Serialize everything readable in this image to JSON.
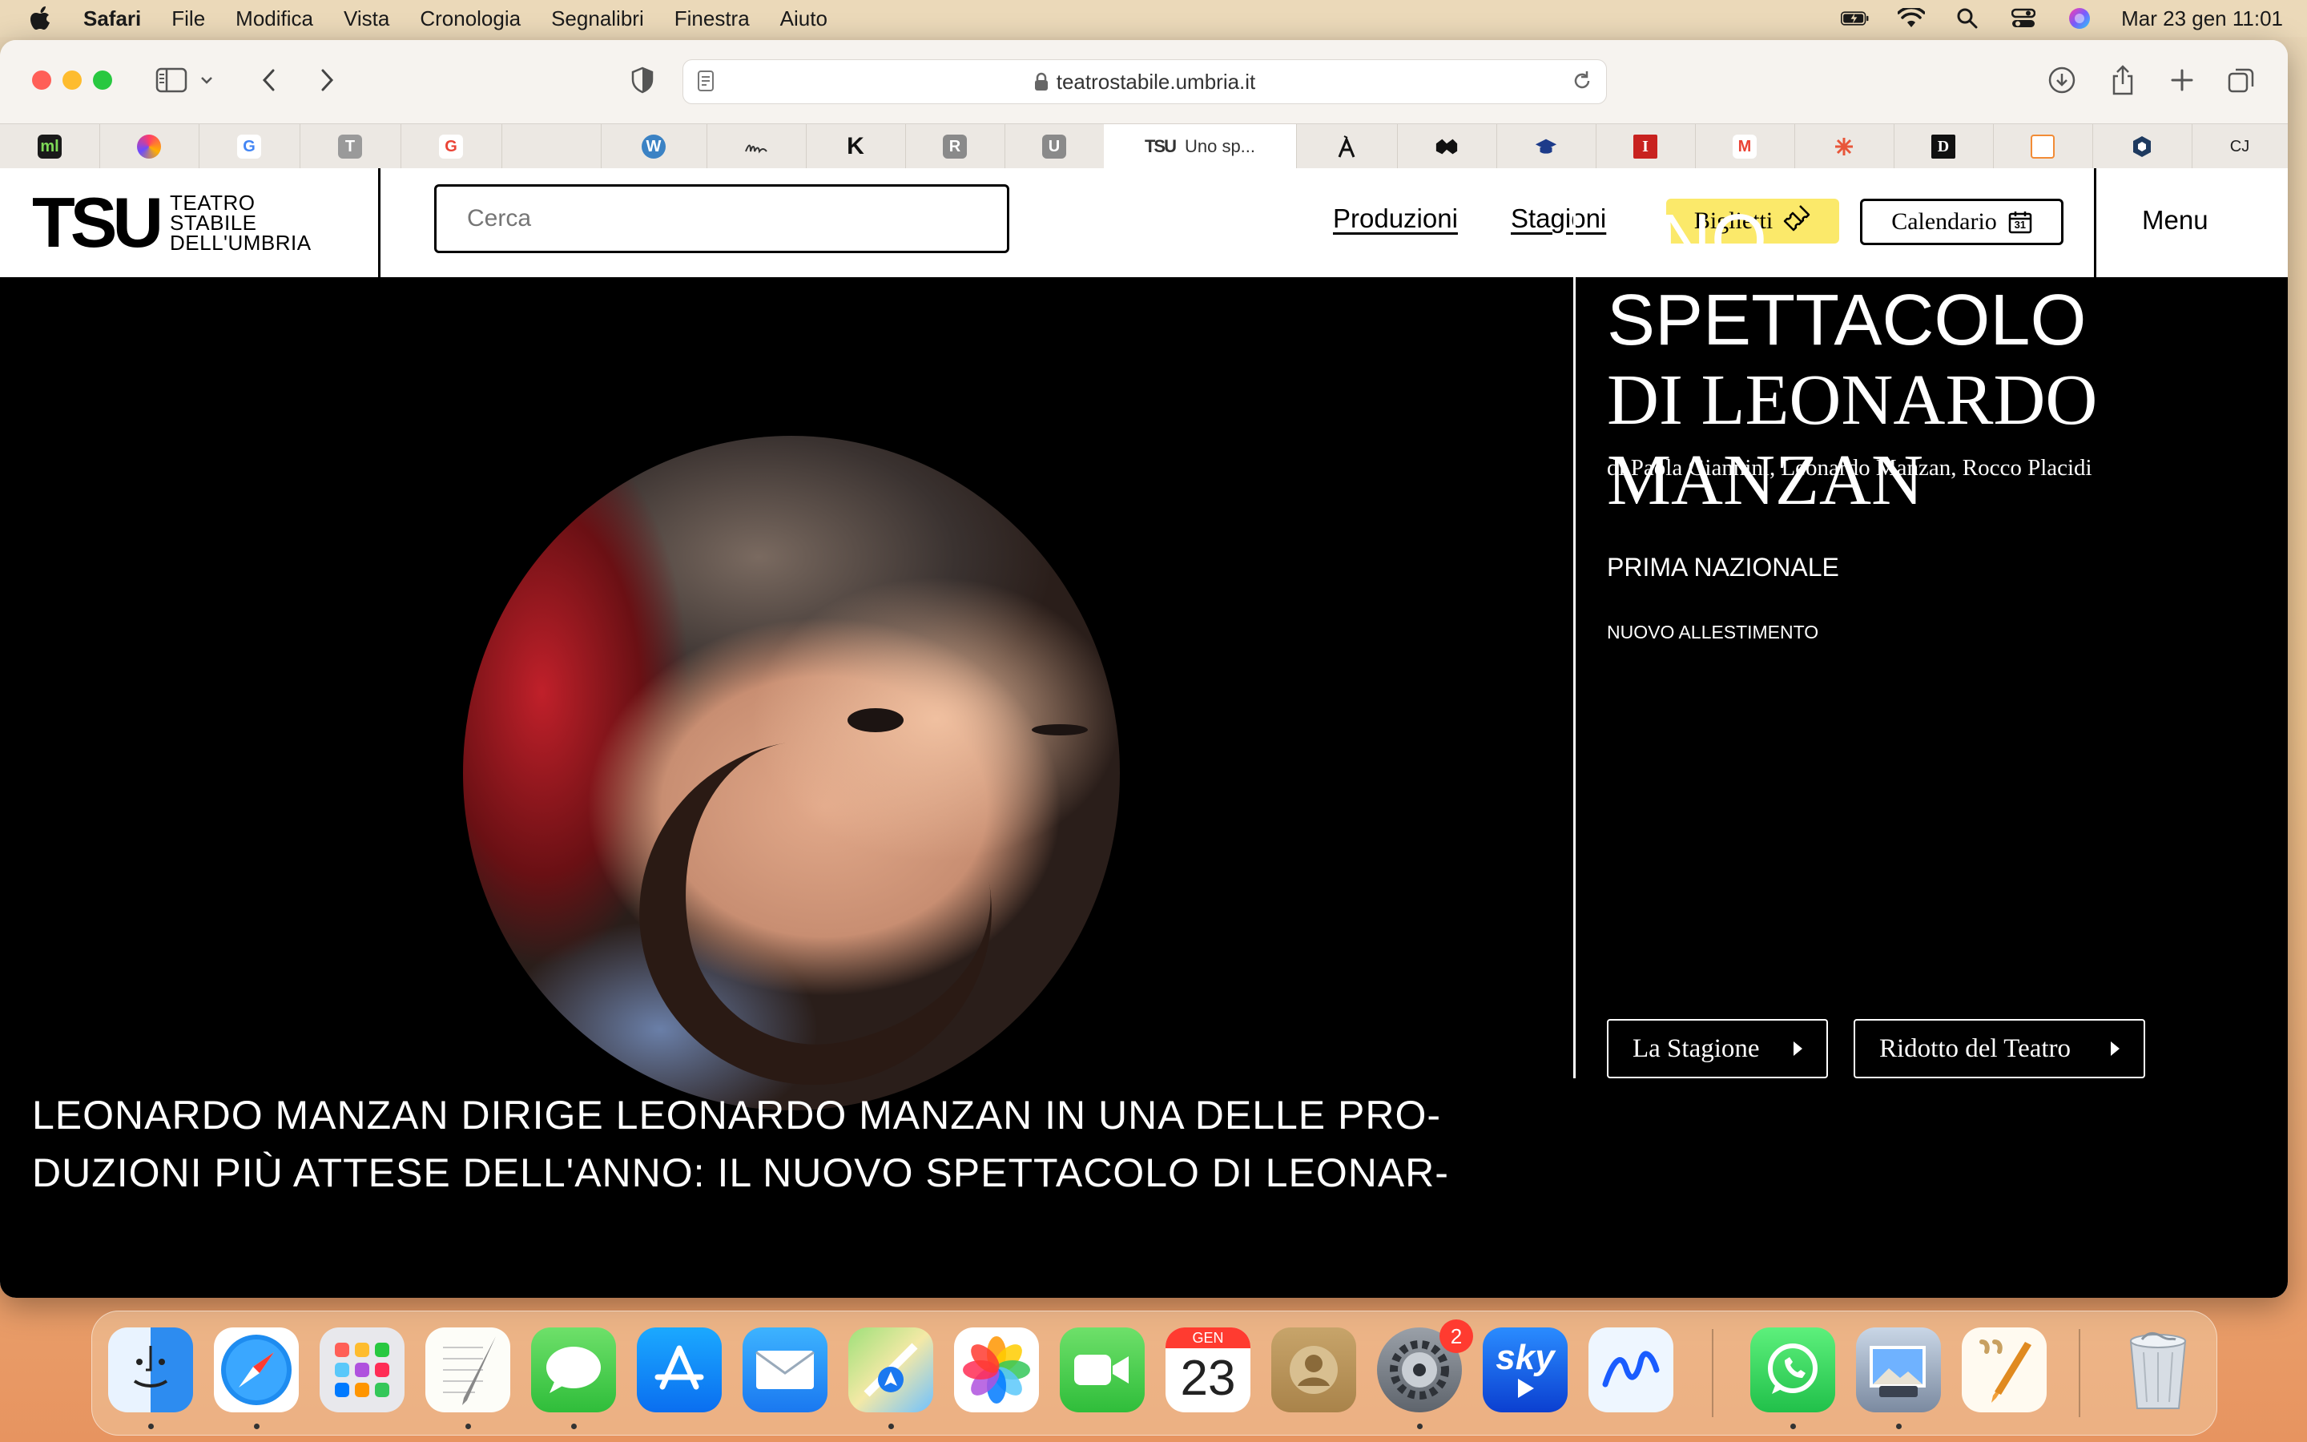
{
  "menubar": {
    "app": "Safari",
    "items": [
      "File",
      "Modifica",
      "Vista",
      "Cronologia",
      "Segnalibri",
      "Finestra",
      "Aiuto"
    ],
    "datetime": "Mar 23 gen  11:01"
  },
  "browser": {
    "url": "teatrostabile.umbria.it",
    "active_tab_label": "Uno sp...",
    "active_tab_favicon_text": "TSU",
    "tabs_favicons": [
      "ml",
      "G",
      "T",
      "G",
      "W",
      "K",
      "R",
      "U",
      "D",
      "I",
      "M",
      "CJ"
    ]
  },
  "site": {
    "logo_mark": "TSU",
    "logo_lines": [
      "TEATRO",
      "STABILE",
      "DELL'UMBRIA"
    ],
    "search_placeholder": "Cerca",
    "nav": {
      "produzioni": "Produzioni",
      "stagioni": "Stagioni"
    },
    "biglietti": "Biglietti",
    "calendario": "Calendario",
    "calendar_day": "31",
    "menu": "Menu"
  },
  "hero": {
    "title_line1": "UNO SPETTACOLO",
    "title_line2": "DI LEONARDO",
    "title_line3": "MANZAN",
    "authors": "di Paola Giannini, Leonardo Manzan, Rocco Placidi",
    "prima": "PRIMA NAZIONALE",
    "allestimento": "NUOVO ALLESTIMENTO",
    "btn_stagione": "La Stagione",
    "btn_ridotto": "Ridotto del Teatro",
    "description_line1": "LEONARDO MANZAN DIRIGE LEONARDO MANZAN IN UNA DELLE PRO-",
    "description_line2": "DUZIONI PIÙ ATTESE DELL'ANNO: IL NUOVO SPETTACOLO DI LEONAR-"
  },
  "dock": {
    "calendar_month": "GEN",
    "calendar_day": "23",
    "settings_badge": "2",
    "sky_label": "sky"
  },
  "colors": {
    "biglietti_bg": "#fbe96a",
    "hero_bg": "#000000"
  }
}
